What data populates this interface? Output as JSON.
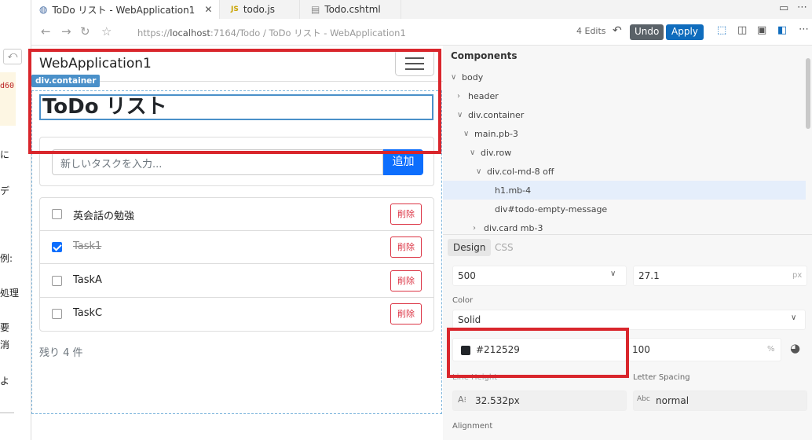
{
  "tabs": [
    {
      "label": "ToDo リスト - WebApplication1",
      "icon": "globe-icon",
      "active": true
    },
    {
      "label": "todo.js",
      "icon": "js-file-icon"
    },
    {
      "label": "Todo.cshtml",
      "icon": "file-icon"
    }
  ],
  "addressbar": {
    "url_prefix": "https://",
    "url_host": "localhost",
    "url_rest": ":7164/Todo / ToDo リスト - WebApplication1",
    "edits": "4 Edits",
    "undo_label": "Undo",
    "apply_label": "Apply"
  },
  "left_strip": {
    "code_text": "d60(",
    "chars": [
      "に",
      "デ",
      "例:",
      "処理",
      "要",
      "消",
      "よ"
    ]
  },
  "app": {
    "brand": "WebApplication1",
    "container_label": "div.container",
    "title": "ToDo リスト",
    "input_placeholder": "新しいタスクを入力...",
    "add_label": "追加",
    "tasks": [
      {
        "text": "英会話の勉強",
        "done": false,
        "delete_label": "削除"
      },
      {
        "text": "Task1",
        "done": true,
        "delete_label": "削除"
      },
      {
        "text": "TaskA",
        "done": false,
        "delete_label": "削除"
      },
      {
        "text": "TaskC",
        "done": false,
        "delete_label": "削除"
      }
    ],
    "remaining": "残り 4 件"
  },
  "panel": {
    "title": "Components",
    "tree": [
      {
        "label": "body",
        "arrow": "∨"
      },
      {
        "label": "header",
        "arrow": "›"
      },
      {
        "label": "div.container",
        "arrow": "∨"
      },
      {
        "label": "main.pb-3",
        "arrow": "∨"
      },
      {
        "label": "div.row",
        "arrow": "∨"
      },
      {
        "label": "div.col-md-8 off",
        "arrow": "∨"
      },
      {
        "label": "h1.mb-4",
        "arrow": "",
        "selected": true
      },
      {
        "label": "div#todo-empty-message",
        "arrow": ""
      },
      {
        "label": "div.card mb-3",
        "arrow": "›"
      }
    ],
    "design_tab": "Design",
    "css_tab": "CSS",
    "font_weight": "500",
    "font_size": "27.1",
    "font_size_unit": "px",
    "color_label": "Color",
    "color_mode": "Solid",
    "color_hex": "#212529",
    "color_swatch": "#212529",
    "opacity": "100",
    "opacity_unit": "%",
    "line_height_label": "Line Height",
    "line_height": "32.532px",
    "letter_spacing_label": "Letter Spacing",
    "letter_spacing": "normal",
    "alignment_label": "Alignment"
  },
  "colors": {
    "accent": "#0f6cbd",
    "highlight": "#d9262c",
    "primary": "#0d6efd",
    "danger": "#dc3545"
  }
}
